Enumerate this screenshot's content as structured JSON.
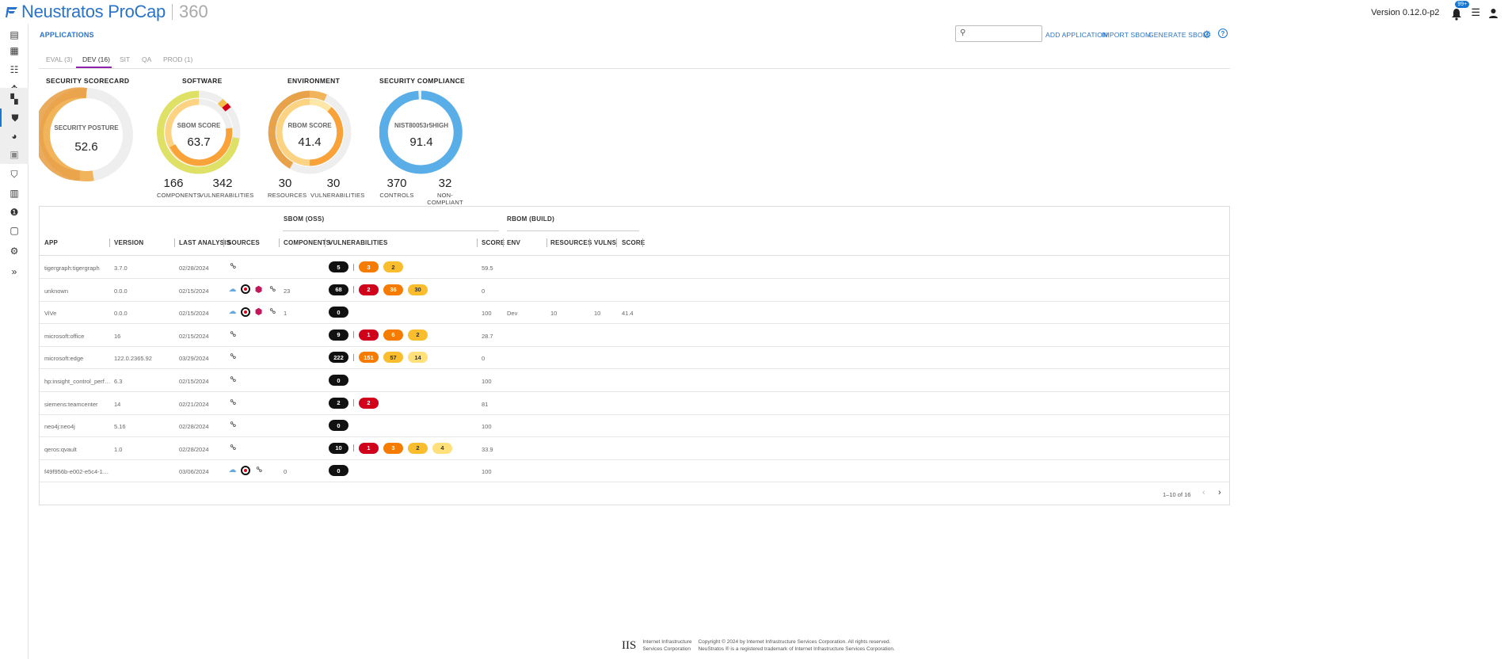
{
  "header": {
    "brand_name": "Neustratos ProCap",
    "brand_suffix": "360",
    "version": "Version 0.12.0-p2",
    "notification_count": "99+",
    "brand_color": "#2a73c8"
  },
  "sidebar": {
    "items": [
      {
        "name": "clipboard-icon",
        "glyph": "▤"
      },
      {
        "name": "dashboard-icon",
        "glyph": "▦"
      },
      {
        "name": "checklist-icon",
        "glyph": "☰"
      },
      {
        "name": "network-icon",
        "glyph": "✥"
      },
      {
        "name": "apps-add-icon",
        "glyph": "▚"
      },
      {
        "name": "shield-icon",
        "glyph": "●"
      },
      {
        "name": "pie-chart-icon",
        "glyph": "◕"
      },
      {
        "name": "image-icon",
        "glyph": "▣"
      },
      {
        "name": "shield-check-icon",
        "glyph": "⬢"
      },
      {
        "name": "document-icon",
        "glyph": "▥"
      },
      {
        "name": "alert-icon",
        "glyph": "●"
      },
      {
        "name": "preview-icon",
        "glyph": "▢"
      },
      {
        "name": "settings-icon",
        "glyph": "⚙"
      },
      {
        "name": "expand-icon",
        "glyph": "»"
      }
    ]
  },
  "page": {
    "title": "APPLICATIONS",
    "search_placeholder": "",
    "actions": [
      "ADD APPLICATION",
      "IMPORT SBOM",
      "GENERATE SBOM"
    ]
  },
  "tabs": [
    "EVAL (3)",
    "DEV (16)",
    "SIT",
    "QA",
    "PROD (1)"
  ],
  "active_tab": "DEV (16)",
  "cards": {
    "scorecard": {
      "title": "SECURITY SCORECARD",
      "label": "SECURITY POSTURE",
      "value": "52.6",
      "fraction": 0.526
    },
    "software": {
      "title": "SOFTWARE",
      "label": "SBOM SCORE",
      "value": "63.7",
      "fraction": 0.637,
      "stats": [
        {
          "num": "166",
          "label": "COMPONENTS"
        },
        {
          "num": "342",
          "label": "VULNERABILITIES"
        }
      ]
    },
    "environment": {
      "title": "ENVIRONMENT",
      "label": "RBOM SCORE",
      "value": "41.4",
      "fraction": 0.414,
      "stats": [
        {
          "num": "30",
          "label": "RESOURCES"
        },
        {
          "num": "30",
          "label": "VULNERABILITIES"
        }
      ]
    },
    "compliance": {
      "title": "SECURITY COMPLIANCE",
      "label": "NIST80053r5HIGH",
      "value": "91.4",
      "fraction": 0.914,
      "stats": [
        {
          "num": "370",
          "label": "CONTROLS"
        },
        {
          "num": "32",
          "label": "NON-COMPLIANT"
        }
      ]
    }
  },
  "table": {
    "group_sbom": "SBOM (OSS)",
    "group_rbom": "RBOM (BUILD)",
    "columns": [
      "APP",
      "VERSION",
      "LAST ANALYSIS",
      "SOURCES",
      "COMPONENTS",
      "VULNERABILITIES",
      "SCORE",
      "ENV",
      "RESOURCES",
      "VULNS",
      "SCORE"
    ],
    "rows": [
      {
        "app": "tigergraph:tigergraph",
        "version": "3.7.0",
        "last": "02/28/2024",
        "sources": [
          "link"
        ],
        "components": "",
        "total": "5",
        "sev": [
          [
            "high",
            "3"
          ],
          [
            "med",
            "2"
          ]
        ],
        "score": "59.5",
        "env": "",
        "resources": "",
        "vulns": "",
        "rscore": ""
      },
      {
        "app": "unknown",
        "version": "0.0.0",
        "last": "02/15/2024",
        "sources": [
          "cloud",
          "target",
          "hex",
          "link"
        ],
        "components": "23",
        "total": "68",
        "sev": [
          [
            "crit",
            "2"
          ],
          [
            "high",
            "36"
          ],
          [
            "med",
            "30"
          ]
        ],
        "score": "0",
        "env": "",
        "resources": "",
        "vulns": "",
        "rscore": ""
      },
      {
        "app": "ViVe",
        "version": "0.0.0",
        "last": "02/15/2024",
        "sources": [
          "cloud",
          "target",
          "hex",
          "link"
        ],
        "components": "1",
        "total": "0",
        "sev": [],
        "score": "100",
        "env": "Dev",
        "resources": "10",
        "vulns": "10",
        "rscore": "41.4"
      },
      {
        "app": "microsoft:office",
        "version": "16",
        "last": "02/15/2024",
        "sources": [
          "link"
        ],
        "components": "",
        "total": "9",
        "sev": [
          [
            "crit",
            "1"
          ],
          [
            "high",
            "6"
          ],
          [
            "med",
            "2"
          ]
        ],
        "score": "28.7",
        "env": "",
        "resources": "",
        "vulns": "",
        "rscore": ""
      },
      {
        "app": "microsoft:edge",
        "version": "122.0.2365.92",
        "last": "03/29/2024",
        "sources": [
          "link"
        ],
        "components": "",
        "total": "222",
        "sev": [
          [
            "high",
            "151"
          ],
          [
            "med",
            "57"
          ],
          [
            "low",
            "14"
          ]
        ],
        "score": "0",
        "env": "",
        "resources": "",
        "vulns": "",
        "rscore": ""
      },
      {
        "app": "hp:insight_control_perf…",
        "version": "6.3",
        "last": "02/15/2024",
        "sources": [
          "link"
        ],
        "components": "",
        "total": "0",
        "sev": [],
        "score": "100",
        "env": "",
        "resources": "",
        "vulns": "",
        "rscore": ""
      },
      {
        "app": "siemens:teamcenter",
        "version": "14",
        "last": "02/21/2024",
        "sources": [
          "link"
        ],
        "components": "",
        "total": "2",
        "sev": [
          [
            "crit",
            "2"
          ]
        ],
        "score": "81",
        "env": "",
        "resources": "",
        "vulns": "",
        "rscore": ""
      },
      {
        "app": "neo4j:neo4j",
        "version": "5.16",
        "last": "02/28/2024",
        "sources": [
          "link"
        ],
        "components": "",
        "total": "0",
        "sev": [],
        "score": "100",
        "env": "",
        "resources": "",
        "vulns": "",
        "rscore": ""
      },
      {
        "app": "qeros:qvault",
        "version": "1.0",
        "last": "02/28/2024",
        "sources": [
          "link"
        ],
        "components": "",
        "total": "10",
        "sev": [
          [
            "crit",
            "1"
          ],
          [
            "high",
            "3"
          ],
          [
            "med",
            "2"
          ],
          [
            "low",
            "4"
          ]
        ],
        "score": "33.9",
        "env": "",
        "resources": "",
        "vulns": "",
        "rscore": ""
      },
      {
        "app": "f49f956b-e002-e5c4-1…",
        "version": "",
        "last": "03/06/2024",
        "sources": [
          "cloud",
          "target",
          "link"
        ],
        "components": "0",
        "total": "0",
        "sev": [],
        "score": "100",
        "env": "",
        "resources": "",
        "vulns": "",
        "rscore": ""
      }
    ],
    "pagination": "1–10 of 16"
  },
  "footer": {
    "logo": "IIS",
    "company_line1": "Internet Infrastructure",
    "company_line2": "Services Corporation",
    "copyright_line1": "Copyright © 2024 by Internet Infrastructure Services Corporation. All rights reserved.",
    "copyright_line2": "NeuStratos ® is a registered trademark of Internet Infrastructure Services Corporation."
  }
}
